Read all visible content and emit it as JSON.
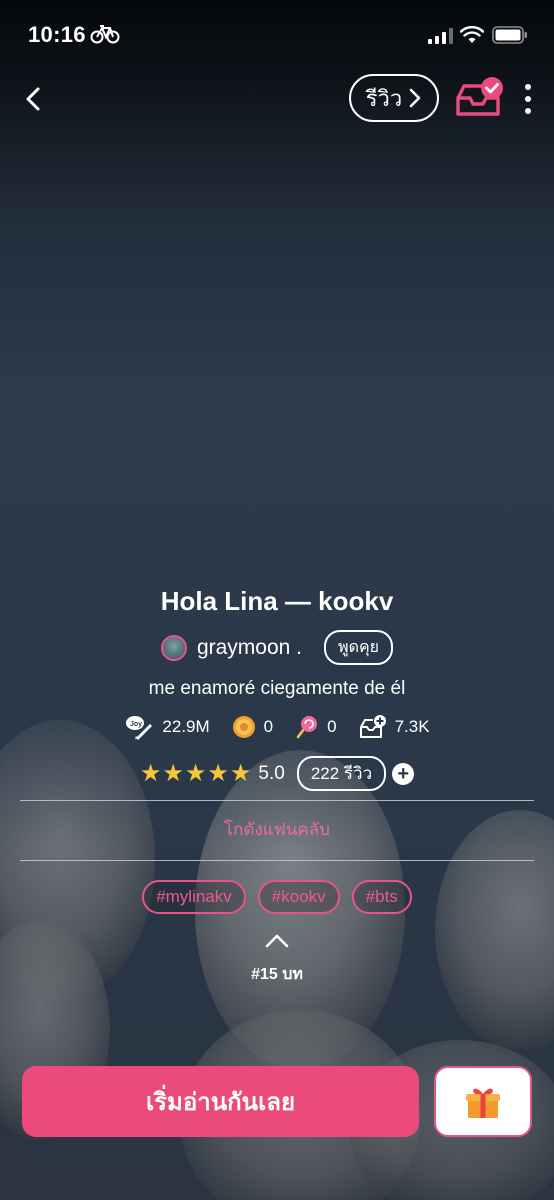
{
  "status_bar": {
    "time": "10:16"
  },
  "nav": {
    "back_icon": "chevron-left-icon",
    "review_label": "รีวิว",
    "inbox_icon": "inbox-check-icon",
    "more_icon": "more-vertical-icon"
  },
  "story": {
    "title": "Hola Lina — kookv",
    "author": "graymoon .",
    "talk_label": "พูดคุย",
    "description": "me enamoré ciegamente de él",
    "stats": [
      {
        "icon": "joy-pen-icon",
        "value": "22.9M"
      },
      {
        "icon": "coin-icon",
        "value": "0"
      },
      {
        "icon": "lollipop-icon",
        "value": "0"
      },
      {
        "icon": "add-shelf-icon",
        "value": "7.3K"
      }
    ],
    "rating": {
      "stars": 5,
      "value": "5.0",
      "reviews_label": "222 รีวิว"
    },
    "fanclub_label": "โกดังแฟนคลับ",
    "tags": [
      "#mylinakv",
      "#kookv",
      "#bts"
    ],
    "chapters_label": "#15 บท"
  },
  "actions": {
    "start_reading_label": "เริ่มอ่านกันเลย",
    "gift_icon": "gift-icon"
  },
  "colors": {
    "accent": "#ea4a7c",
    "star": "#f5c63b",
    "background": "#2b394b"
  }
}
